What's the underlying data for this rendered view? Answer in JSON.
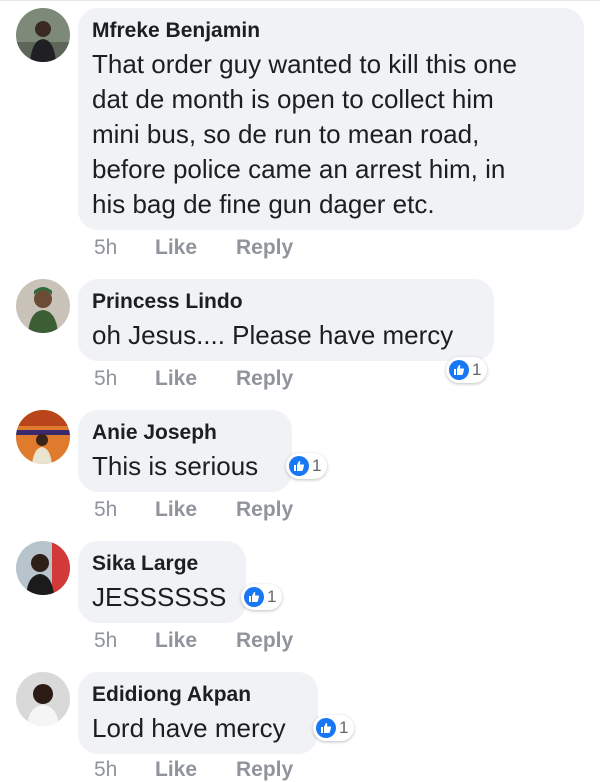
{
  "comments": [
    {
      "author": "Mfreke Benjamin",
      "lines": [
        "That order guy wanted to kill this one",
        "dat de month is open to collect him",
        "mini bus, so de run to mean road,",
        "before police came an arrest him, in",
        "his bag de fine gun dager etc."
      ],
      "time": "5h",
      "like": "Like",
      "reply": "Reply",
      "reactions": null
    },
    {
      "author": "Princess Lindo",
      "lines": [
        "oh Jesus.... Please have mercy"
      ],
      "time": "5h",
      "like": "Like",
      "reply": "Reply",
      "reactions": "1"
    },
    {
      "author": "Anie Joseph",
      "lines": [
        "This is serious"
      ],
      "time": "5h",
      "like": "Like",
      "reply": "Reply",
      "reactions": "1"
    },
    {
      "author": "Sika Large",
      "lines": [
        "JESSSSSS"
      ],
      "time": "5h",
      "like": "Like",
      "reply": "Reply",
      "reactions": "1"
    },
    {
      "author": "Edidiong Akpan",
      "lines": [
        "Lord have mercy"
      ],
      "time": "5h",
      "like": "Like",
      "reply": "Reply",
      "reactions": "1"
    }
  ],
  "colors": {
    "bubble_bg": "#f0f2f5",
    "meta_text": "#90949c",
    "like_blue": "#1877f2"
  }
}
